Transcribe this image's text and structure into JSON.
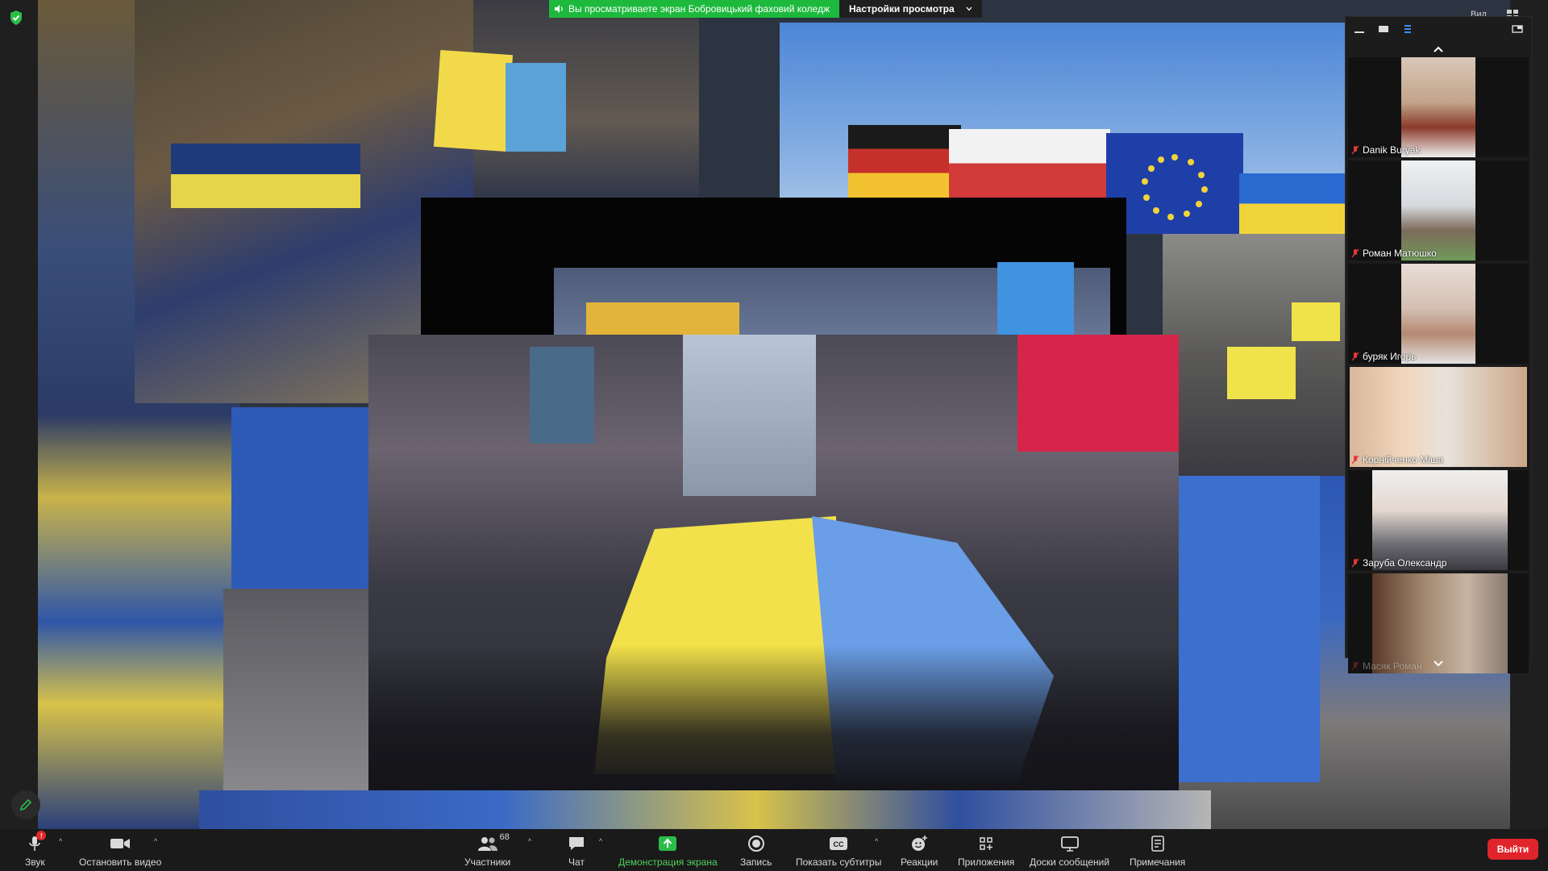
{
  "share_banner": {
    "message": "Вы просматриваете экран Бобровицький фаховий коледж",
    "options_label": "Настройки просмотра"
  },
  "top_right": {
    "view_label": "Вид"
  },
  "participants": [
    {
      "name": "Danik Buryak",
      "muted": true
    },
    {
      "name": "Роман Матюшко",
      "muted": true
    },
    {
      "name": "буряк Игорь",
      "muted": true
    },
    {
      "name": "Корнійченко Міша",
      "muted": true
    },
    {
      "name": "Заруба Олександр",
      "muted": true
    },
    {
      "name": "Масяк Роман",
      "muted": true
    }
  ],
  "toolbar": {
    "audio": "Звук",
    "audio_badge": "!",
    "video": "Остановить видео",
    "participants": "Участники",
    "participants_count": "68",
    "chat": "Чат",
    "share": "Демонстрация экрана",
    "record": "Запись",
    "captions": "Показать субтитры",
    "reactions": "Реакции",
    "apps": "Приложения",
    "whiteboards": "Доски сообщений",
    "notes": "Примечания",
    "leave": "Выйти"
  },
  "colors": {
    "banner_green": "#1db93d",
    "leave_red": "#e0242b",
    "share_label_green": "#4fd35a",
    "ua_blue": "#2a6ad0",
    "ua_yellow": "#f1d33a"
  },
  "icons": [
    "shield-icon",
    "speaker-icon",
    "grid-icon",
    "minimize-icon",
    "single-view-icon",
    "speaker-view-icon",
    "popout-icon",
    "chevron-up-icon",
    "chevron-down-icon",
    "mic-muted-icon",
    "mic-icon",
    "camera-icon",
    "people-icon",
    "chat-icon",
    "share-icon",
    "record-icon",
    "cc-icon",
    "reaction-icon",
    "apps-icon",
    "whiteboard-icon",
    "notes-icon",
    "pencil-icon"
  ]
}
